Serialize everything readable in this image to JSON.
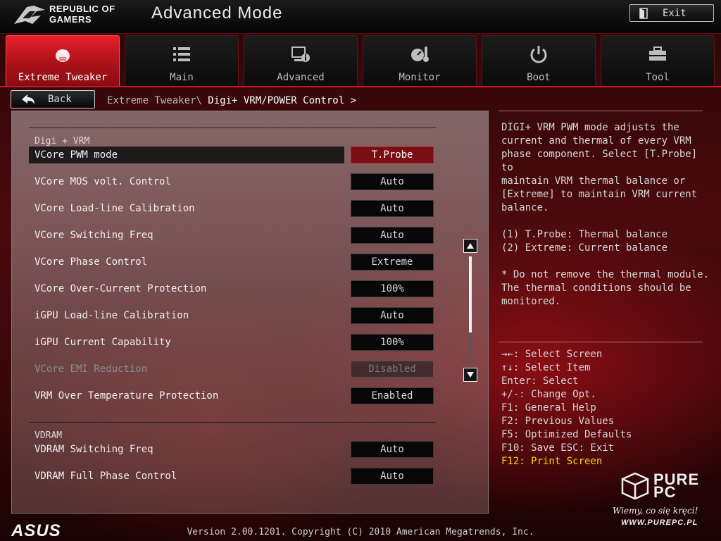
{
  "header": {
    "logo_text_line1": "REPUBLIC OF",
    "logo_text_line2": "GAMERS",
    "mode_title": "Advanced Mode",
    "exit_label": "Exit"
  },
  "tabs": [
    {
      "label": "Extreme Tweaker",
      "icon": "tweaker-icon",
      "active": true
    },
    {
      "label": "Main",
      "icon": "list-icon",
      "active": false
    },
    {
      "label": "Advanced",
      "icon": "advanced-settings-icon",
      "active": false
    },
    {
      "label": "Monitor",
      "icon": "monitor-gauge-icon",
      "active": false
    },
    {
      "label": "Boot",
      "icon": "power-icon",
      "active": false
    },
    {
      "label": "Tool",
      "icon": "toolbox-icon",
      "active": false
    }
  ],
  "nav": {
    "back_label": "Back",
    "breadcrumb_parent": "Extreme Tweaker\\",
    "breadcrumb_current": "Digi+ VRM/POWER Control >"
  },
  "sections": [
    {
      "label": "Digi + VRM",
      "rows": [
        {
          "label": "VCore PWM mode",
          "value": "T.Probe",
          "selected": true,
          "disabled": false
        },
        {
          "label": "VCore MOS volt. Control",
          "value": "Auto",
          "selected": false,
          "disabled": false
        },
        {
          "label": "VCore Load-line Calibration",
          "value": "Auto",
          "selected": false,
          "disabled": false
        },
        {
          "label": "VCore Switching Freq",
          "value": "Auto",
          "selected": false,
          "disabled": false
        },
        {
          "label": "VCore Phase Control",
          "value": "Extreme",
          "selected": false,
          "disabled": false
        },
        {
          "label": "VCore Over-Current Protection",
          "value": "100%",
          "selected": false,
          "disabled": false
        },
        {
          "label": "iGPU Load-line Calibration",
          "value": "Auto",
          "selected": false,
          "disabled": false
        },
        {
          "label": "iGPU Current Capability",
          "value": "100%",
          "selected": false,
          "disabled": false
        },
        {
          "label": "VCore EMI Reduction",
          "value": "Disabled",
          "selected": false,
          "disabled": true
        },
        {
          "label": "VRM Over Temperature Protection",
          "value": "Enabled",
          "selected": false,
          "disabled": false
        }
      ]
    },
    {
      "label": "VDRAM",
      "rows": [
        {
          "label": "VDRAM Switching Freq",
          "value": "Auto",
          "selected": false,
          "disabled": false
        },
        {
          "label": "VDRAM Full Phase Control",
          "value": "Auto",
          "selected": false,
          "disabled": false
        }
      ]
    }
  ],
  "help": {
    "lines": [
      "DIGI+ VRM PWM mode adjusts the",
      "current and thermal of every VRM",
      "phase component. Select [T.Probe] to",
      "maintain VRM thermal balance or",
      "[Extreme] to maintain VRM current",
      "balance.",
      "",
      "(1) T.Probe: Thermal balance",
      "(2) Extreme: Current balance",
      "",
      "* Do not remove the thermal module.",
      "The thermal conditions should be",
      "monitored."
    ]
  },
  "keys": [
    "→←: Select Screen",
    "↑↓: Select Item",
    "Enter: Select",
    "+/-: Change Opt.",
    "F1: General Help",
    "F2: Previous Values",
    "F5: Optimized Defaults",
    "F10: Save  ESC: Exit",
    "F12: Print Screen"
  ],
  "highlight_key_index": 8,
  "footer": {
    "brand": "ASUS",
    "version": "Version 2.00.1201. Copyright (C) 2010 American Megatrends, Inc."
  },
  "watermark": {
    "line1": "PURE",
    "line2": "PC",
    "tagline": "Wiemy, co się kręci!",
    "url": "WWW.PUREPC.PL"
  },
  "colors": {
    "accent_red": "#c41820",
    "active_tab": "#e8202a",
    "selected_value": "#7a0e14",
    "highlight_key": "#ffd400"
  }
}
